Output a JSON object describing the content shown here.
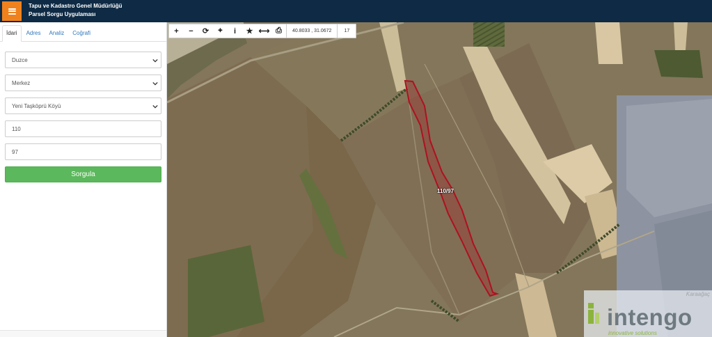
{
  "header": {
    "menu_icon": "hamburger-icon",
    "title_line1": "Tapu ve Kadastro Genel Müdürlüğü",
    "title_line2": "Parsel Sorgu Uygulaması",
    "bg_color": "#0e2a44",
    "menu_color": "#f0821e"
  },
  "sidebar": {
    "tabs": [
      {
        "label": "İdari",
        "active": true
      },
      {
        "label": "Adres",
        "active": false
      },
      {
        "label": "Analiz",
        "active": false
      },
      {
        "label": "Coğrafi",
        "active": false
      }
    ],
    "form": {
      "il": "Duzce",
      "ilce": "Merkez",
      "mahalle": "Yeni Taşköprü Köyü",
      "ada": "110",
      "parsel": "97"
    },
    "query_button": "Sorgula",
    "button_color": "#5cb85c"
  },
  "map": {
    "toolbar": {
      "tools": [
        "plus-icon",
        "minus-icon",
        "refresh-icon",
        "locate-icon",
        "info-icon",
        "star-icon",
        "measure-icon",
        "print-icon"
      ],
      "plus": "+",
      "minus": "−",
      "refresh": "⟳",
      "locate": "⌖",
      "info": "i",
      "star": "★",
      "measure": "⟷",
      "print": "⎙",
      "coordinates": "40.8033 , 31.0672",
      "zoom": "17"
    },
    "parcel_label": "110/97",
    "parcel_color": "#b01020"
  },
  "watermark": {
    "corner": "Karaağaç",
    "name": "intengo",
    "subtitle": "innovative solutions"
  }
}
